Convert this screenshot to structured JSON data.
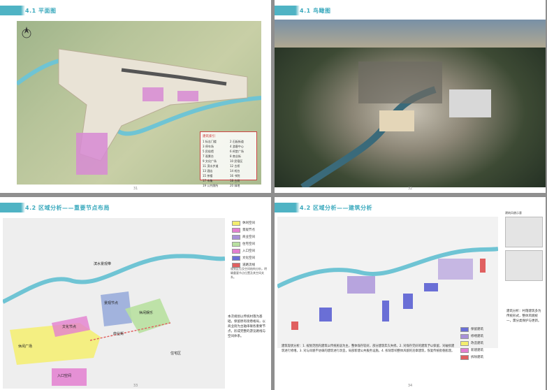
{
  "colors": {
    "accent": "#4fb3c4",
    "river": "#6fc4d4",
    "pink": "#e37fd0",
    "yellow": "#f4ee6e",
    "green": "#b8e0a0",
    "blue": "#6a6fd6",
    "purple": "#a890d8",
    "red": "#e06060"
  },
  "pages": [
    {
      "title": "4.1 平面图",
      "number": "31",
      "legend_title": "建筑索引",
      "legend_items": [
        "1 标志门楼",
        "2 石板街道",
        "3 停车场",
        "4 游客中心",
        "5 民俗馆",
        "6 祠堂广场",
        "7 观景台",
        "8 商业街",
        "9 文化广场",
        "10 民宿区",
        "11 滨水步道",
        "12 古桥",
        "13 酒店",
        "14 戏台",
        "15 茶楼",
        "16 书院",
        "17 市集",
        "18 古树",
        "19 公共厕所",
        "20 绿地"
      ]
    },
    {
      "title": "4.1 鸟瞰图",
      "number": "32"
    },
    {
      "title": "4.2 区域分析——重要节点布局",
      "number": "33",
      "legend_items": [
        "休闲空间",
        "景观节点",
        "商业空间",
        "住宅空间",
        "入口空间",
        "文化空间",
        "道路流线"
      ],
      "note": "规划区位及空间结构分析，明确重要节点位置及其空间关系。",
      "labels": [
        "滨水景观带",
        "休闲娱乐",
        "景观节点",
        "文化节点",
        "入口空间",
        "商业街",
        "休闲广场",
        "住宅区"
      ],
      "body": "本次规划以传统村落为基础，保留原有街巷格局，以商业街为主轴串联各重要节点，形成完整的游览路线与空间体系。"
    },
    {
      "title": "4.2 区域分析——建筑分析",
      "number": "34",
      "legend_items": [
        "保留建筑",
        "修缮建筑",
        "改造建筑",
        "新建建筑",
        "拆除建筑"
      ],
      "body": "建筑现状分析：1. 规划范围内建筑以传统民居为主，整体保存较好，部分建筑年久失修。2. 对保存完好的建筑予以保留，对破损建筑进行修缮。3. 对与风貌不协调的建筑进行改造，局部新建公共服务设施。4. 拆除影响整体风貌的违章建筑，恢复传统街巷肌理。",
      "side_caption": "建筑风貌示意",
      "side_text": "建筑分析：村落建筑多为传统形式，整体风貌统一，需分类保护与更新。"
    }
  ]
}
